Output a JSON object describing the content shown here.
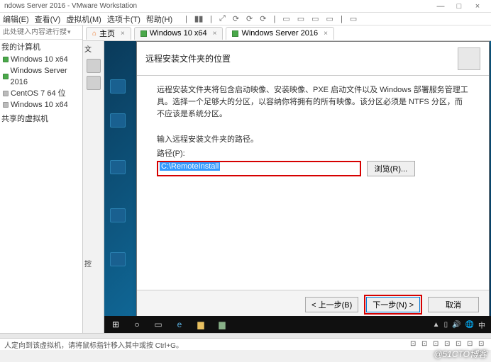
{
  "window": {
    "title": "ndows Server 2016 - VMware Workstation",
    "min": "—",
    "max": "□",
    "close": "×"
  },
  "menu": {
    "edit": "编辑(E)",
    "view": "查看(V)",
    "vm": "虚拟机(M)",
    "tabs": "选项卡(T)",
    "help": "帮助(H)"
  },
  "search_placeholder": "此处键入内容进行搜索",
  "tree": {
    "header": "我的计算机",
    "items": [
      {
        "name": "Windows 10 x64",
        "on": true
      },
      {
        "name": "Windows Server 2016",
        "on": true
      },
      {
        "name": "CentOS 7 64 位",
        "on": false
      },
      {
        "name": "Windows 10 x64",
        "on": false
      }
    ],
    "shared": "共享的虚拟机"
  },
  "tabs": {
    "home": "主页",
    "vm1": "Windows 10 x64",
    "vm2": "Windows Server 2016"
  },
  "sidebar_label": "文",
  "sidebar_label2": "控",
  "wizard": {
    "title": "远程安装文件夹的位置",
    "description": "远程安装文件夹将包含启动映像、安装映像、PXE 启动文件以及 Windows 部署服务管理工具。选择一个足够大的分区，以容纳你将拥有的所有映像。该分区必须是 NTFS 分区，而不应该是系统分区。",
    "prompt": "输入远程安装文件夹的路径。",
    "path_label": "路径(P):",
    "path_value": "C:\\RemoteInstall",
    "browse": "浏览(R)...",
    "back": "< 上一步(B)",
    "next": "下一步(N) >",
    "cancel": "取消"
  },
  "statusbar": "人定向到该虚拟机，请将鼠标指针移入其中或按 Ctrl+G。",
  "watermark": "@51CTO博客"
}
